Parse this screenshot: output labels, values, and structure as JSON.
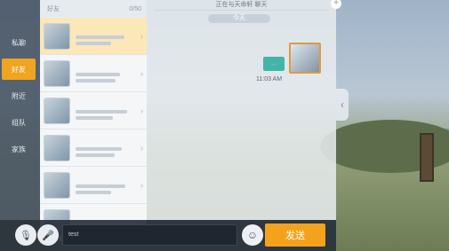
{
  "rail": {
    "tabs": [
      {
        "label": "私聊",
        "active": false
      },
      {
        "label": "好友",
        "active": true
      },
      {
        "label": "附近",
        "active": false
      },
      {
        "label": "组队",
        "active": false
      },
      {
        "label": "家族",
        "active": false
      }
    ]
  },
  "friend_list": {
    "header_left": "好友",
    "header_right": "0/50",
    "rows": [
      {
        "name": "",
        "selected": true
      },
      {
        "name": "",
        "selected": false
      },
      {
        "name": "",
        "selected": false
      },
      {
        "name": "",
        "selected": false
      },
      {
        "name": "",
        "selected": false
      },
      {
        "name": "",
        "selected": false
      }
    ]
  },
  "chat": {
    "header": "正在与天命轩    聊天",
    "date_label": "今天",
    "sender": "",
    "bubble_text": "·.·",
    "time": "11:03 AM"
  },
  "input": {
    "value": "test"
  },
  "buttons": {
    "send": "发送"
  },
  "icons": {
    "voice_to_text": "mic-icon",
    "voice": "mic-icon",
    "emoji": "emoji-icon",
    "collapse": "chevron-left-icon",
    "add": "plus-icon"
  }
}
